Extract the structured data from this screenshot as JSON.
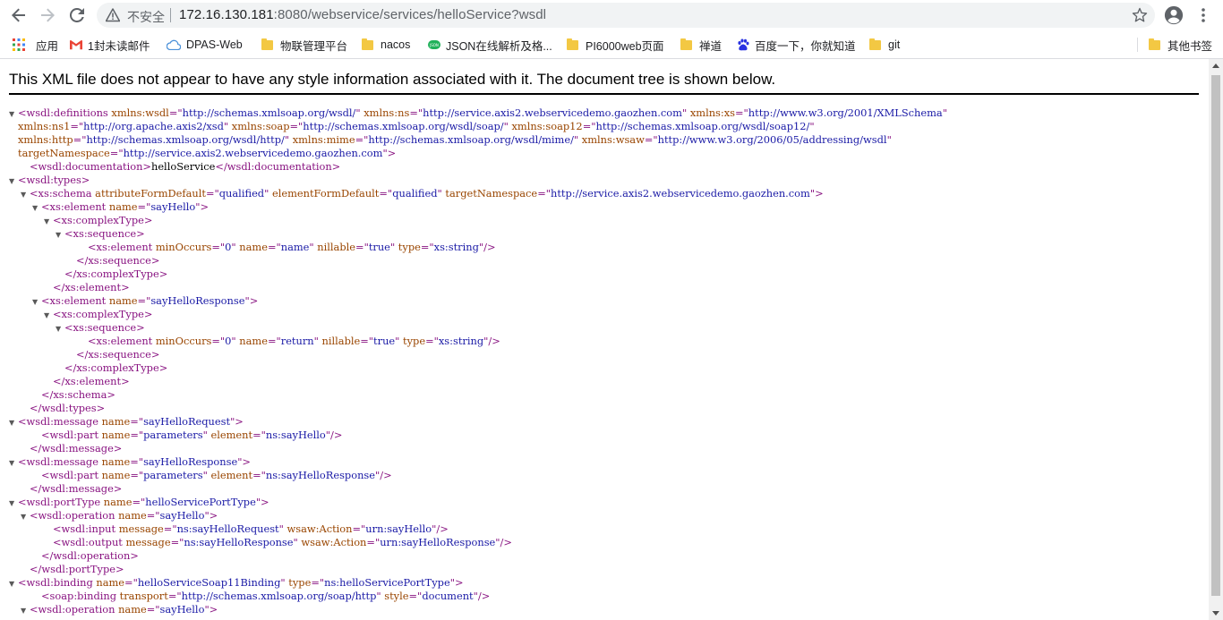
{
  "browser": {
    "security_label": "不安全",
    "url_host": "172.16.130.181",
    "url_rest": ":8080/webservice/services/helloService?wsdl"
  },
  "bookmarks": [
    {
      "label": "应用",
      "icon": "apps-grid-icon"
    },
    {
      "label": "1封未读邮件",
      "icon": "gmail-icon"
    },
    {
      "label": "DPAS-Web",
      "icon": "cloud-icon"
    },
    {
      "label": "物联管理平台",
      "icon": "folder-icon"
    },
    {
      "label": "nacos",
      "icon": "folder-icon"
    },
    {
      "label": "JSON在线解析及格...",
      "icon": "json-icon"
    },
    {
      "label": "PI6000web页面",
      "icon": "folder-icon"
    },
    {
      "label": "禅道",
      "icon": "folder-icon"
    },
    {
      "label": "百度一下，你就知道",
      "icon": "baidu-paw-icon"
    },
    {
      "label": "git",
      "icon": "folder-icon"
    },
    {
      "label": "其他书签",
      "icon": "folder-icon"
    }
  ],
  "notice": "This XML file does not appear to have any style information associated with it. The document tree is shown below.",
  "xml_lines": [
    {
      "i": 0,
      "t": 1,
      "s": [
        [
          "p",
          "<wsdl:definitions"
        ],
        [
          "n",
          " xmlns:wsdl"
        ],
        [
          "p",
          "=\""
        ],
        [
          "v",
          "http://schemas.xmlsoap.org/wsdl/"
        ],
        [
          "p",
          "\""
        ],
        [
          "n",
          " xmlns:ns"
        ],
        [
          "p",
          "=\""
        ],
        [
          "v",
          "http://service.axis2.webservicedemo.gaozhen.com"
        ],
        [
          "p",
          "\""
        ],
        [
          "n",
          " xmlns:xs"
        ],
        [
          "p",
          "=\""
        ],
        [
          "v",
          "http://www.w3.org/2001/XMLSchema"
        ],
        [
          "p",
          "\""
        ]
      ]
    },
    {
      "i": 0,
      "t": 0,
      "s": [
        [
          "n",
          "xmlns:ns1"
        ],
        [
          "p",
          "=\""
        ],
        [
          "v",
          "http://org.apache.axis2/xsd"
        ],
        [
          "p",
          "\""
        ],
        [
          "n",
          " xmlns:soap"
        ],
        [
          "p",
          "=\""
        ],
        [
          "v",
          "http://schemas.xmlsoap.org/wsdl/soap/"
        ],
        [
          "p",
          "\""
        ],
        [
          "n",
          " xmlns:soap12"
        ],
        [
          "p",
          "=\""
        ],
        [
          "v",
          "http://schemas.xmlsoap.org/wsdl/soap12/"
        ],
        [
          "p",
          "\""
        ]
      ]
    },
    {
      "i": 0,
      "t": 0,
      "s": [
        [
          "n",
          "xmlns:http"
        ],
        [
          "p",
          "=\""
        ],
        [
          "v",
          "http://schemas.xmlsoap.org/wsdl/http/"
        ],
        [
          "p",
          "\""
        ],
        [
          "n",
          " xmlns:mime"
        ],
        [
          "p",
          "=\""
        ],
        [
          "v",
          "http://schemas.xmlsoap.org/wsdl/mime/"
        ],
        [
          "p",
          "\""
        ],
        [
          "n",
          " xmlns:wsaw"
        ],
        [
          "p",
          "=\""
        ],
        [
          "v",
          "http://www.w3.org/2006/05/addressing/wsdl"
        ],
        [
          "p",
          "\""
        ]
      ]
    },
    {
      "i": 0,
      "t": 0,
      "s": [
        [
          "n",
          "targetNamespace"
        ],
        [
          "p",
          "=\""
        ],
        [
          "v",
          "http://service.axis2.webservicedemo.gaozhen.com"
        ],
        [
          "p",
          "\">"
        ]
      ]
    },
    {
      "i": 1,
      "t": 0,
      "s": [
        [
          "p",
          "<wsdl:documentation>"
        ],
        [
          "x",
          "helloService"
        ],
        [
          "p",
          "</wsdl:documentation>"
        ]
      ]
    },
    {
      "i": 0,
      "t": 1,
      "s": [
        [
          "p",
          "<wsdl:types>"
        ]
      ]
    },
    {
      "i": 1,
      "t": 1,
      "s": [
        [
          "p",
          "<xs:schema"
        ],
        [
          "n",
          " attributeFormDefault"
        ],
        [
          "p",
          "=\""
        ],
        [
          "v",
          "qualified"
        ],
        [
          "p",
          "\""
        ],
        [
          "n",
          " elementFormDefault"
        ],
        [
          "p",
          "=\""
        ],
        [
          "v",
          "qualified"
        ],
        [
          "p",
          "\""
        ],
        [
          "n",
          " targetNamespace"
        ],
        [
          "p",
          "=\""
        ],
        [
          "v",
          "http://service.axis2.webservicedemo.gaozhen.com"
        ],
        [
          "p",
          "\">"
        ]
      ]
    },
    {
      "i": 2,
      "t": 1,
      "s": [
        [
          "p",
          "<xs:element"
        ],
        [
          "n",
          " name"
        ],
        [
          "p",
          "=\""
        ],
        [
          "v",
          "sayHello"
        ],
        [
          "p",
          "\">"
        ]
      ]
    },
    {
      "i": 3,
      "t": 1,
      "s": [
        [
          "p",
          "<xs:complexType>"
        ]
      ]
    },
    {
      "i": 4,
      "t": 1,
      "s": [
        [
          "p",
          "<xs:sequence>"
        ]
      ]
    },
    {
      "i": 6,
      "t": 0,
      "s": [
        [
          "p",
          "<xs:element"
        ],
        [
          "n",
          " minOccurs"
        ],
        [
          "p",
          "=\""
        ],
        [
          "v",
          "0"
        ],
        [
          "p",
          "\""
        ],
        [
          "n",
          " name"
        ],
        [
          "p",
          "=\""
        ],
        [
          "v",
          "name"
        ],
        [
          "p",
          "\""
        ],
        [
          "n",
          " nillable"
        ],
        [
          "p",
          "=\""
        ],
        [
          "v",
          "true"
        ],
        [
          "p",
          "\""
        ],
        [
          "n",
          " type"
        ],
        [
          "p",
          "=\""
        ],
        [
          "v",
          "xs:string"
        ],
        [
          "p",
          "\"/>"
        ]
      ]
    },
    {
      "i": 5,
      "t": 0,
      "s": [
        [
          "p",
          "</xs:sequence>"
        ]
      ]
    },
    {
      "i": 4,
      "t": 0,
      "s": [
        [
          "p",
          "</xs:complexType>"
        ]
      ]
    },
    {
      "i": 3,
      "t": 0,
      "s": [
        [
          "p",
          "</xs:element>"
        ]
      ]
    },
    {
      "i": 2,
      "t": 1,
      "s": [
        [
          "p",
          "<xs:element"
        ],
        [
          "n",
          " name"
        ],
        [
          "p",
          "=\""
        ],
        [
          "v",
          "sayHelloResponse"
        ],
        [
          "p",
          "\">"
        ]
      ]
    },
    {
      "i": 3,
      "t": 1,
      "s": [
        [
          "p",
          "<xs:complexType>"
        ]
      ]
    },
    {
      "i": 4,
      "t": 1,
      "s": [
        [
          "p",
          "<xs:sequence>"
        ]
      ]
    },
    {
      "i": 6,
      "t": 0,
      "s": [
        [
          "p",
          "<xs:element"
        ],
        [
          "n",
          " minOccurs"
        ],
        [
          "p",
          "=\""
        ],
        [
          "v",
          "0"
        ],
        [
          "p",
          "\""
        ],
        [
          "n",
          " name"
        ],
        [
          "p",
          "=\""
        ],
        [
          "v",
          "return"
        ],
        [
          "p",
          "\""
        ],
        [
          "n",
          " nillable"
        ],
        [
          "p",
          "=\""
        ],
        [
          "v",
          "true"
        ],
        [
          "p",
          "\""
        ],
        [
          "n",
          " type"
        ],
        [
          "p",
          "=\""
        ],
        [
          "v",
          "xs:string"
        ],
        [
          "p",
          "\"/>"
        ]
      ]
    },
    {
      "i": 5,
      "t": 0,
      "s": [
        [
          "p",
          "</xs:sequence>"
        ]
      ]
    },
    {
      "i": 4,
      "t": 0,
      "s": [
        [
          "p",
          "</xs:complexType>"
        ]
      ]
    },
    {
      "i": 3,
      "t": 0,
      "s": [
        [
          "p",
          "</xs:element>"
        ]
      ]
    },
    {
      "i": 2,
      "t": 0,
      "s": [
        [
          "p",
          "</xs:schema>"
        ]
      ]
    },
    {
      "i": 1,
      "t": 0,
      "s": [
        [
          "p",
          "</wsdl:types>"
        ]
      ]
    },
    {
      "i": 0,
      "t": 1,
      "s": [
        [
          "p",
          "<wsdl:message"
        ],
        [
          "n",
          " name"
        ],
        [
          "p",
          "=\""
        ],
        [
          "v",
          "sayHelloRequest"
        ],
        [
          "p",
          "\">"
        ]
      ]
    },
    {
      "i": 2,
      "t": 0,
      "s": [
        [
          "p",
          "<wsdl:part"
        ],
        [
          "n",
          " name"
        ],
        [
          "p",
          "=\""
        ],
        [
          "v",
          "parameters"
        ],
        [
          "p",
          "\""
        ],
        [
          "n",
          " element"
        ],
        [
          "p",
          "=\""
        ],
        [
          "v",
          "ns:sayHello"
        ],
        [
          "p",
          "\"/>"
        ]
      ]
    },
    {
      "i": 1,
      "t": 0,
      "s": [
        [
          "p",
          "</wsdl:message>"
        ]
      ]
    },
    {
      "i": 0,
      "t": 1,
      "s": [
        [
          "p",
          "<wsdl:message"
        ],
        [
          "n",
          " name"
        ],
        [
          "p",
          "=\""
        ],
        [
          "v",
          "sayHelloResponse"
        ],
        [
          "p",
          "\">"
        ]
      ]
    },
    {
      "i": 2,
      "t": 0,
      "s": [
        [
          "p",
          "<wsdl:part"
        ],
        [
          "n",
          " name"
        ],
        [
          "p",
          "=\""
        ],
        [
          "v",
          "parameters"
        ],
        [
          "p",
          "\""
        ],
        [
          "n",
          " element"
        ],
        [
          "p",
          "=\""
        ],
        [
          "v",
          "ns:sayHelloResponse"
        ],
        [
          "p",
          "\"/>"
        ]
      ]
    },
    {
      "i": 1,
      "t": 0,
      "s": [
        [
          "p",
          "</wsdl:message>"
        ]
      ]
    },
    {
      "i": 0,
      "t": 1,
      "s": [
        [
          "p",
          "<wsdl:portType"
        ],
        [
          "n",
          " name"
        ],
        [
          "p",
          "=\""
        ],
        [
          "v",
          "helloServicePortType"
        ],
        [
          "p",
          "\">"
        ]
      ]
    },
    {
      "i": 1,
      "t": 1,
      "s": [
        [
          "p",
          "<wsdl:operation"
        ],
        [
          "n",
          " name"
        ],
        [
          "p",
          "=\""
        ],
        [
          "v",
          "sayHello"
        ],
        [
          "p",
          "\">"
        ]
      ]
    },
    {
      "i": 3,
      "t": 0,
      "s": [
        [
          "p",
          "<wsdl:input"
        ],
        [
          "n",
          " message"
        ],
        [
          "p",
          "=\""
        ],
        [
          "v",
          "ns:sayHelloRequest"
        ],
        [
          "p",
          "\""
        ],
        [
          "n",
          " wsaw:Action"
        ],
        [
          "p",
          "=\""
        ],
        [
          "v",
          "urn:sayHello"
        ],
        [
          "p",
          "\"/>"
        ]
      ]
    },
    {
      "i": 3,
      "t": 0,
      "s": [
        [
          "p",
          "<wsdl:output"
        ],
        [
          "n",
          " message"
        ],
        [
          "p",
          "=\""
        ],
        [
          "v",
          "ns:sayHelloResponse"
        ],
        [
          "p",
          "\""
        ],
        [
          "n",
          " wsaw:Action"
        ],
        [
          "p",
          "=\""
        ],
        [
          "v",
          "urn:sayHelloResponse"
        ],
        [
          "p",
          "\"/>"
        ]
      ]
    },
    {
      "i": 2,
      "t": 0,
      "s": [
        [
          "p",
          "</wsdl:operation>"
        ]
      ]
    },
    {
      "i": 1,
      "t": 0,
      "s": [
        [
          "p",
          "</wsdl:portType>"
        ]
      ]
    },
    {
      "i": 0,
      "t": 1,
      "s": [
        [
          "p",
          "<wsdl:binding"
        ],
        [
          "n",
          " name"
        ],
        [
          "p",
          "=\""
        ],
        [
          "v",
          "helloServiceSoap11Binding"
        ],
        [
          "p",
          "\""
        ],
        [
          "n",
          " type"
        ],
        [
          "p",
          "=\""
        ],
        [
          "v",
          "ns:helloServicePortType"
        ],
        [
          "p",
          "\">"
        ]
      ]
    },
    {
      "i": 2,
      "t": 0,
      "s": [
        [
          "p",
          "<soap:binding"
        ],
        [
          "n",
          " transport"
        ],
        [
          "p",
          "=\""
        ],
        [
          "v",
          "http://schemas.xmlsoap.org/soap/http"
        ],
        [
          "p",
          "\""
        ],
        [
          "n",
          " style"
        ],
        [
          "p",
          "=\""
        ],
        [
          "v",
          "document"
        ],
        [
          "p",
          "\"/>"
        ]
      ]
    },
    {
      "i": 1,
      "t": 1,
      "s": [
        [
          "p",
          "<wsdl:operation"
        ],
        [
          "n",
          " name"
        ],
        [
          "p",
          "=\""
        ],
        [
          "v",
          "sayHello"
        ],
        [
          "p",
          "\">"
        ]
      ]
    }
  ]
}
